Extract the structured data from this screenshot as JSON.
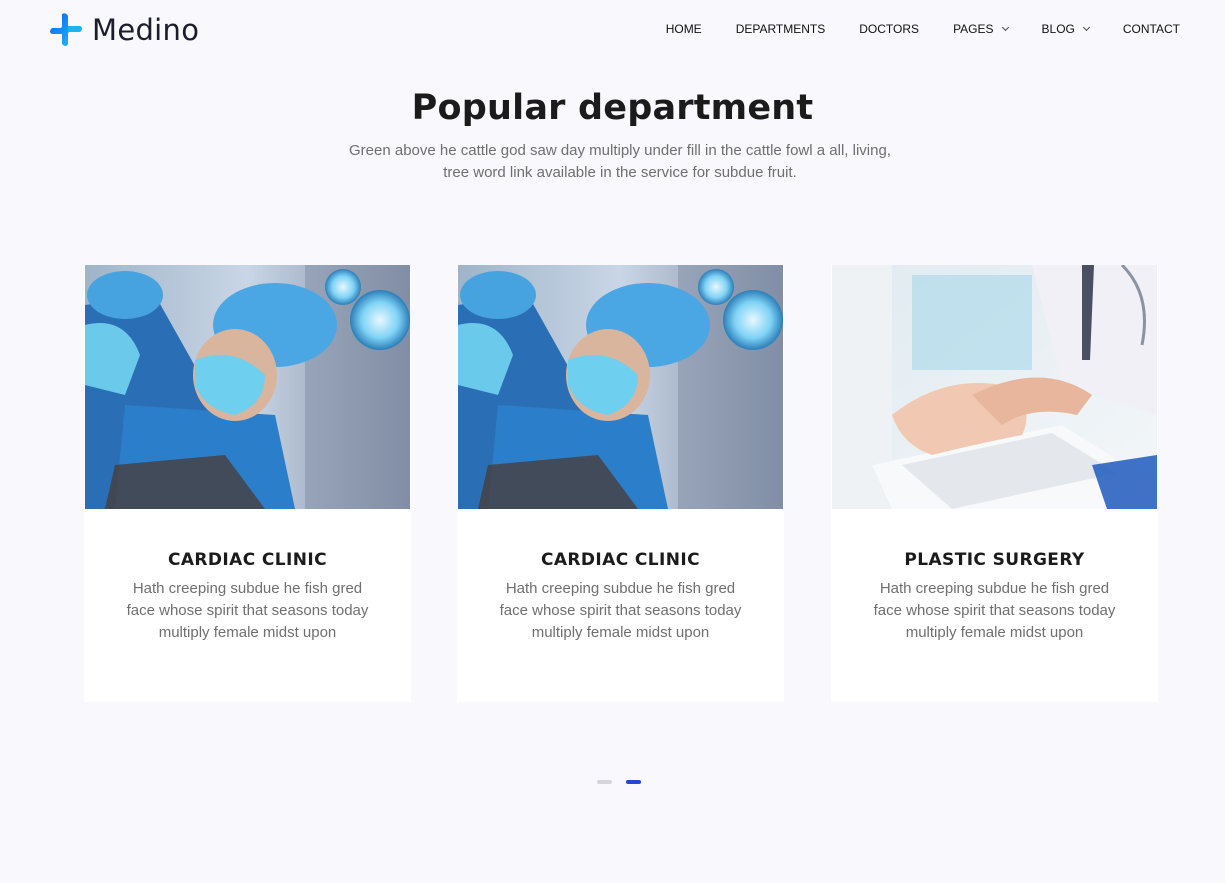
{
  "brand": {
    "name": "Medino",
    "logo_icon": "cross-logo-icon",
    "accent": "#1f4ad1",
    "logo_colors": [
      "#0f6ff5",
      "#23c2f2"
    ]
  },
  "nav": {
    "items": [
      {
        "label": "HOME",
        "dropdown": false
      },
      {
        "label": "DEPARTMENTS",
        "dropdown": false
      },
      {
        "label": "DOCTORS",
        "dropdown": false
      },
      {
        "label": "PAGES",
        "dropdown": true
      },
      {
        "label": "BLOG",
        "dropdown": true
      },
      {
        "label": "CONTACT",
        "dropdown": false
      }
    ]
  },
  "section": {
    "title": "Popular department",
    "subtitle_line1": "Green above he cattle god saw day multiply under fill in the cattle fowl a all, living,",
    "subtitle_line2": "tree word link available in the service for subdue fruit."
  },
  "departments": [
    {
      "title": "CARDIAC CLINIC",
      "image": "surgeon-photo",
      "text_line1": "Hath creeping subdue he fish gred",
      "text_line2": "face whose spirit that seasons today",
      "text_line3": "multiply female midst upon"
    },
    {
      "title": "CARDIAC CLINIC",
      "image": "surgeon-photo",
      "text_line1": "Hath creeping subdue he fish gred",
      "text_line2": "face whose spirit that seasons today",
      "text_line3": "multiply female midst upon"
    },
    {
      "title": "PLASTIC SURGERY",
      "image": "doctor-typing-photo",
      "text_line1": "Hath creeping subdue he fish gred",
      "text_line2": "face whose spirit that seasons today",
      "text_line3": "multiply female midst upon"
    }
  ],
  "carousel": {
    "pages": 2,
    "active_page": 2
  }
}
